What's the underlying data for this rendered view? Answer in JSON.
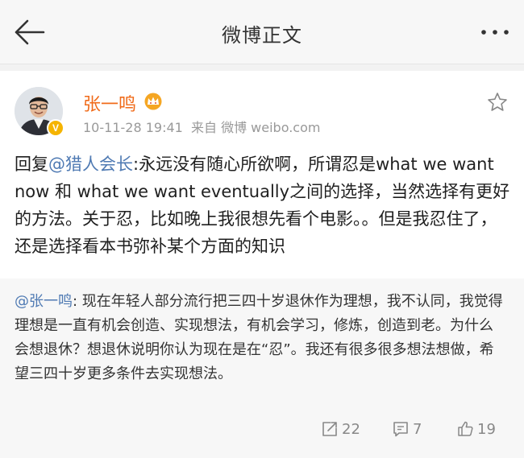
{
  "nav": {
    "title": "微博正文"
  },
  "post": {
    "username": "张一鸣",
    "timestamp": "10-11-28 19:41",
    "source": "来自 微博 weibo.com",
    "verified_badge": "V",
    "reply_prefix": "回复",
    "reply_mention": "@猎人会长",
    "content": ":永远没有随心所欲啊，所谓忍是what we want now 和 what we want eventually之间的选择，当然选择有更好的方法。关于忍，比如晚上我很想先看个电影。。但是我忍住了，还是选择看本书弥补某个方面的知识"
  },
  "retweet": {
    "mention": "@张一鸣",
    "content": ": 现在年轻人部分流行把三四十岁退休作为理想，我不认同，我觉得理想是一直有机会创造、实现想法，有机会学习，修炼，创造到老。为什么会想退休？想退休说明你认为现在是在“忍”。我还有很多很多想法想做，希望三四十岁更多条件去实现想法。",
    "repost_count": "22",
    "comment_count": "7",
    "like_count": "19"
  },
  "colors": {
    "username": "#f06b1a",
    "link": "#4f7ab3",
    "badge": "#f5b400"
  },
  "icons": {
    "back": "back-arrow-icon",
    "more": "more-dots-icon",
    "favorite": "star-icon",
    "crown": "crown-icon",
    "repost": "repost-icon",
    "comment": "comment-icon",
    "like": "thumbs-up-icon"
  }
}
